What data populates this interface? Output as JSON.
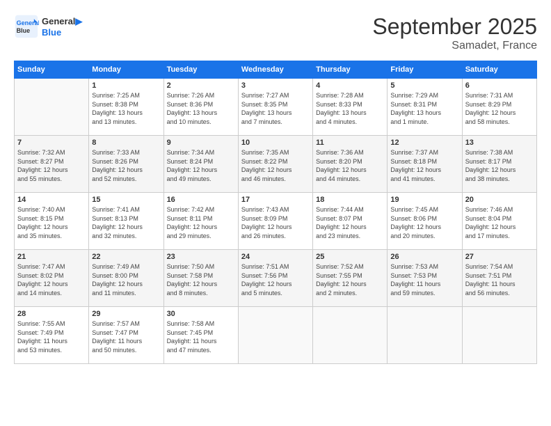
{
  "logo": {
    "line1": "General",
    "line2": "Blue"
  },
  "title": "September 2025",
  "location": "Samadet, France",
  "weekdays": [
    "Sunday",
    "Monday",
    "Tuesday",
    "Wednesday",
    "Thursday",
    "Friday",
    "Saturday"
  ],
  "weeks": [
    [
      {
        "day": "",
        "info": ""
      },
      {
        "day": "1",
        "info": "Sunrise: 7:25 AM\nSunset: 8:38 PM\nDaylight: 13 hours\nand 13 minutes."
      },
      {
        "day": "2",
        "info": "Sunrise: 7:26 AM\nSunset: 8:36 PM\nDaylight: 13 hours\nand 10 minutes."
      },
      {
        "day": "3",
        "info": "Sunrise: 7:27 AM\nSunset: 8:35 PM\nDaylight: 13 hours\nand 7 minutes."
      },
      {
        "day": "4",
        "info": "Sunrise: 7:28 AM\nSunset: 8:33 PM\nDaylight: 13 hours\nand 4 minutes."
      },
      {
        "day": "5",
        "info": "Sunrise: 7:29 AM\nSunset: 8:31 PM\nDaylight: 13 hours\nand 1 minute."
      },
      {
        "day": "6",
        "info": "Sunrise: 7:31 AM\nSunset: 8:29 PM\nDaylight: 12 hours\nand 58 minutes."
      }
    ],
    [
      {
        "day": "7",
        "info": "Sunrise: 7:32 AM\nSunset: 8:27 PM\nDaylight: 12 hours\nand 55 minutes."
      },
      {
        "day": "8",
        "info": "Sunrise: 7:33 AM\nSunset: 8:26 PM\nDaylight: 12 hours\nand 52 minutes."
      },
      {
        "day": "9",
        "info": "Sunrise: 7:34 AM\nSunset: 8:24 PM\nDaylight: 12 hours\nand 49 minutes."
      },
      {
        "day": "10",
        "info": "Sunrise: 7:35 AM\nSunset: 8:22 PM\nDaylight: 12 hours\nand 46 minutes."
      },
      {
        "day": "11",
        "info": "Sunrise: 7:36 AM\nSunset: 8:20 PM\nDaylight: 12 hours\nand 44 minutes."
      },
      {
        "day": "12",
        "info": "Sunrise: 7:37 AM\nSunset: 8:18 PM\nDaylight: 12 hours\nand 41 minutes."
      },
      {
        "day": "13",
        "info": "Sunrise: 7:38 AM\nSunset: 8:17 PM\nDaylight: 12 hours\nand 38 minutes."
      }
    ],
    [
      {
        "day": "14",
        "info": "Sunrise: 7:40 AM\nSunset: 8:15 PM\nDaylight: 12 hours\nand 35 minutes."
      },
      {
        "day": "15",
        "info": "Sunrise: 7:41 AM\nSunset: 8:13 PM\nDaylight: 12 hours\nand 32 minutes."
      },
      {
        "day": "16",
        "info": "Sunrise: 7:42 AM\nSunset: 8:11 PM\nDaylight: 12 hours\nand 29 minutes."
      },
      {
        "day": "17",
        "info": "Sunrise: 7:43 AM\nSunset: 8:09 PM\nDaylight: 12 hours\nand 26 minutes."
      },
      {
        "day": "18",
        "info": "Sunrise: 7:44 AM\nSunset: 8:07 PM\nDaylight: 12 hours\nand 23 minutes."
      },
      {
        "day": "19",
        "info": "Sunrise: 7:45 AM\nSunset: 8:06 PM\nDaylight: 12 hours\nand 20 minutes."
      },
      {
        "day": "20",
        "info": "Sunrise: 7:46 AM\nSunset: 8:04 PM\nDaylight: 12 hours\nand 17 minutes."
      }
    ],
    [
      {
        "day": "21",
        "info": "Sunrise: 7:47 AM\nSunset: 8:02 PM\nDaylight: 12 hours\nand 14 minutes."
      },
      {
        "day": "22",
        "info": "Sunrise: 7:49 AM\nSunset: 8:00 PM\nDaylight: 12 hours\nand 11 minutes."
      },
      {
        "day": "23",
        "info": "Sunrise: 7:50 AM\nSunset: 7:58 PM\nDaylight: 12 hours\nand 8 minutes."
      },
      {
        "day": "24",
        "info": "Sunrise: 7:51 AM\nSunset: 7:56 PM\nDaylight: 12 hours\nand 5 minutes."
      },
      {
        "day": "25",
        "info": "Sunrise: 7:52 AM\nSunset: 7:55 PM\nDaylight: 12 hours\nand 2 minutes."
      },
      {
        "day": "26",
        "info": "Sunrise: 7:53 AM\nSunset: 7:53 PM\nDaylight: 11 hours\nand 59 minutes."
      },
      {
        "day": "27",
        "info": "Sunrise: 7:54 AM\nSunset: 7:51 PM\nDaylight: 11 hours\nand 56 minutes."
      }
    ],
    [
      {
        "day": "28",
        "info": "Sunrise: 7:55 AM\nSunset: 7:49 PM\nDaylight: 11 hours\nand 53 minutes."
      },
      {
        "day": "29",
        "info": "Sunrise: 7:57 AM\nSunset: 7:47 PM\nDaylight: 11 hours\nand 50 minutes."
      },
      {
        "day": "30",
        "info": "Sunrise: 7:58 AM\nSunset: 7:45 PM\nDaylight: 11 hours\nand 47 minutes."
      },
      {
        "day": "",
        "info": ""
      },
      {
        "day": "",
        "info": ""
      },
      {
        "day": "",
        "info": ""
      },
      {
        "day": "",
        "info": ""
      }
    ]
  ]
}
